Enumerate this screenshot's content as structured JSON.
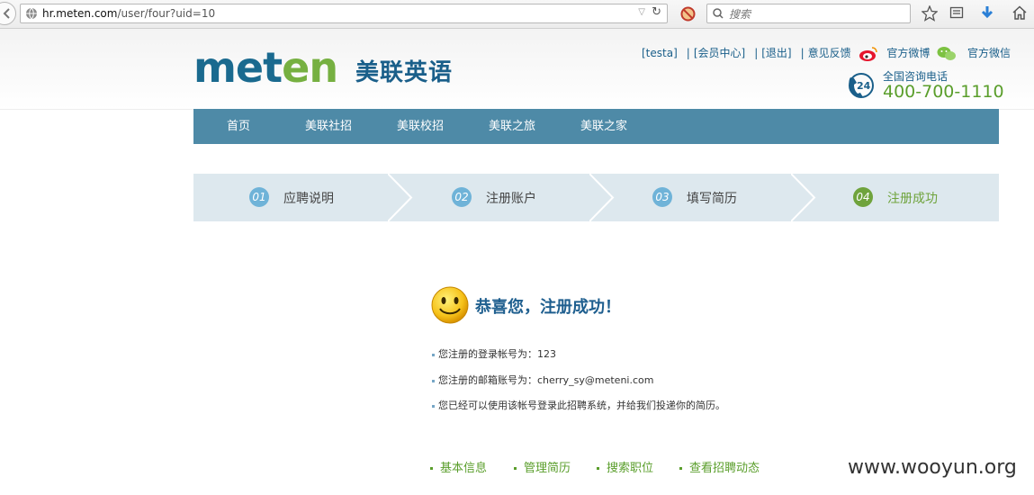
{
  "browser": {
    "url_host": "hr.meten.com",
    "url_path": "/user/four?uid=10",
    "search_placeholder": "搜索"
  },
  "header": {
    "logo_en_part1": "met",
    "logo_en_part2": "en",
    "logo_cn": "美联英语",
    "links": {
      "user": "[testa]",
      "member_center": "[会员中心]",
      "logout": "[退出]",
      "feedback": "意见反馈",
      "weibo": "官方微博",
      "wechat": "官方微信"
    },
    "hotline_label": "全国咨询电话",
    "hotline_number": "400-700-1110",
    "hotline_badge": "24"
  },
  "nav": {
    "items": [
      "首页",
      "美联社招",
      "美联校招",
      "美联之旅",
      "美联之家"
    ]
  },
  "steps": [
    {
      "num": "01",
      "label": "应聘说明",
      "active": false
    },
    {
      "num": "02",
      "label": "注册账户",
      "active": false
    },
    {
      "num": "03",
      "label": "填写简历",
      "active": false
    },
    {
      "num": "04",
      "label": "注册成功",
      "active": true
    }
  ],
  "success": {
    "title": "恭喜您，注册成功！",
    "lines": [
      "您注册的登录帐号为：123",
      "您注册的邮箱账号为：cherry_sy@meteni.com",
      "您已经可以使用该帐号登录此招聘系统，并给我们投递你的简历。"
    ]
  },
  "bottom_links": [
    "基本信息",
    "管理简历",
    "搜索职位",
    "查看招聘动态"
  ],
  "watermark": "www.wooyun.org",
  "colors": {
    "nav_bg": "#4e8aa7",
    "brand_blue": "#1a6a8f",
    "brand_green": "#76b041",
    "step_bg": "#dde8ee"
  }
}
